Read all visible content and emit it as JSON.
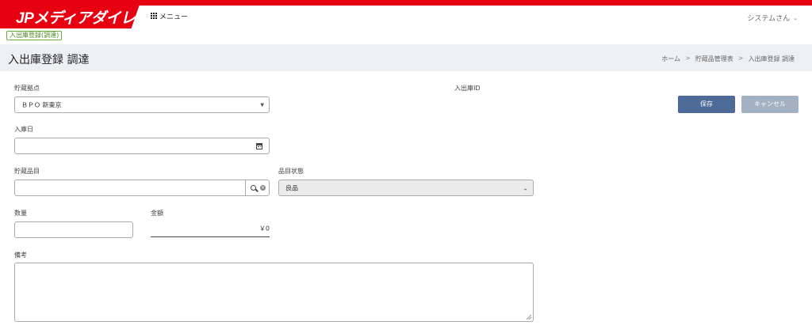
{
  "header": {
    "logo": "JPメディアダイレクト",
    "menu_label": "メニュー",
    "user_label": "システムさん"
  },
  "badge": "入出庫登録(調達)",
  "page": {
    "title": "入出庫登録 調達",
    "breadcrumb": [
      "ホーム",
      "貯蔵品管理表",
      "入出庫登録 調達"
    ],
    "breadcrumb_sep": ">"
  },
  "form": {
    "storage_location": {
      "label": "貯蔵拠点",
      "value": "ＢＰＯ 新東京"
    },
    "inout_id": {
      "label": "入出庫ID",
      "value": ""
    },
    "stock_date": {
      "label": "入庫日",
      "value": ""
    },
    "item": {
      "label": "貯蔵品目",
      "value": ""
    },
    "item_status": {
      "label": "品目状態",
      "value": "良品"
    },
    "quantity": {
      "label": "数量",
      "value": ""
    },
    "amount": {
      "label": "金額",
      "value": "￥0"
    },
    "remarks": {
      "label": "備考",
      "value": ""
    }
  },
  "buttons": {
    "save": "保存",
    "cancel": "キャンセル"
  },
  "colors": {
    "brand_red": "#e60012",
    "save": "#4d6b96",
    "cancel": "#a3b1c2",
    "badge_green": "#6aaa3c"
  }
}
